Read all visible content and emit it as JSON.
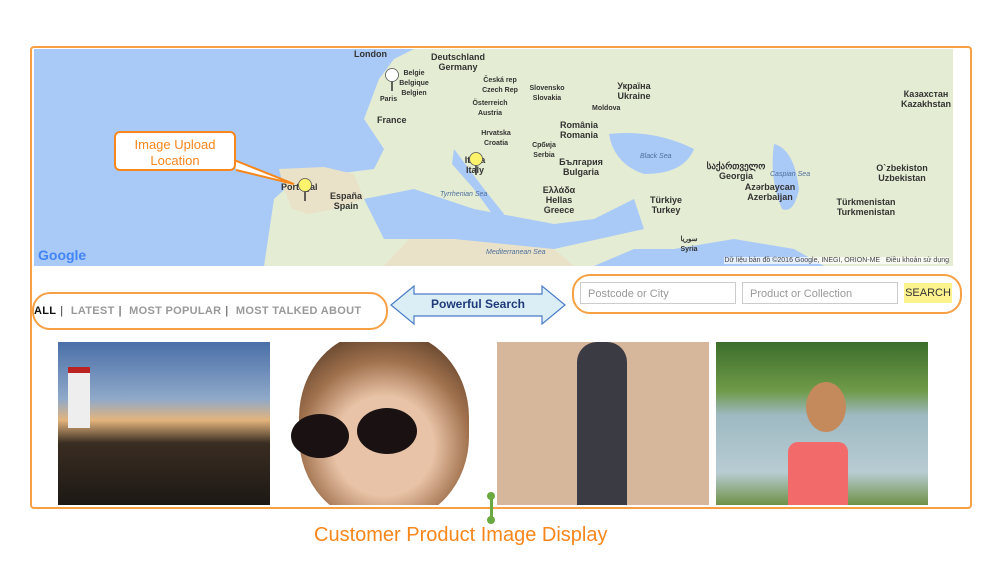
{
  "map": {
    "labels": [
      "London",
      "Deutschland Germany",
      "Belgie Belgique Belgien",
      "Paris",
      "France",
      "Česká rep Czech Rep",
      "Slovensko Slovakia",
      "Österreich Austria",
      "Україна Ukraine",
      "Moldova",
      "Hrvatska Croatia",
      "Србија Serbia",
      "România Romania",
      "Italia Italy",
      "España Spain",
      "Portugal",
      "България Bulgaria",
      "Ελλάδα Hellas Greece",
      "Türkiye Turkey",
      "საქართველო Georgia",
      "Azərbaycan Azerbaijan",
      "Казахстан Kazakhstan",
      "O`zbekiston Uzbekistan",
      "Türkmenistan Turkmenistan",
      "سوريا Syria"
    ],
    "seas": [
      "Black Sea",
      "Tyrrhenian Sea",
      "Mediterranean Sea",
      "Caspian Sea"
    ],
    "attribution": "Dữ liệu bản đồ ©2016 Google, INEGI, ORION-ME",
    "terms": "Điều khoản sử dụng",
    "logo": "Google",
    "zoom_in": "+",
    "zoom_out": "−"
  },
  "callout": "Image Upload Location",
  "filters": [
    "ALL",
    "LATEST",
    "MOST POPULAR",
    "MOST TALKED ABOUT"
  ],
  "powerful_search": "Powerful Search",
  "search": {
    "postcode_placeholder": "Postcode or City",
    "product_placeholder": "Product or Collection",
    "button": "SEARCH"
  },
  "caption": "Customer Product Image Display",
  "colors": {
    "accent": "#f7861b",
    "search_button": "#fcf38f",
    "arrow_fill": "#dbeef6",
    "arrow_stroke": "#4a7cc7",
    "connector": "#6aa842"
  }
}
